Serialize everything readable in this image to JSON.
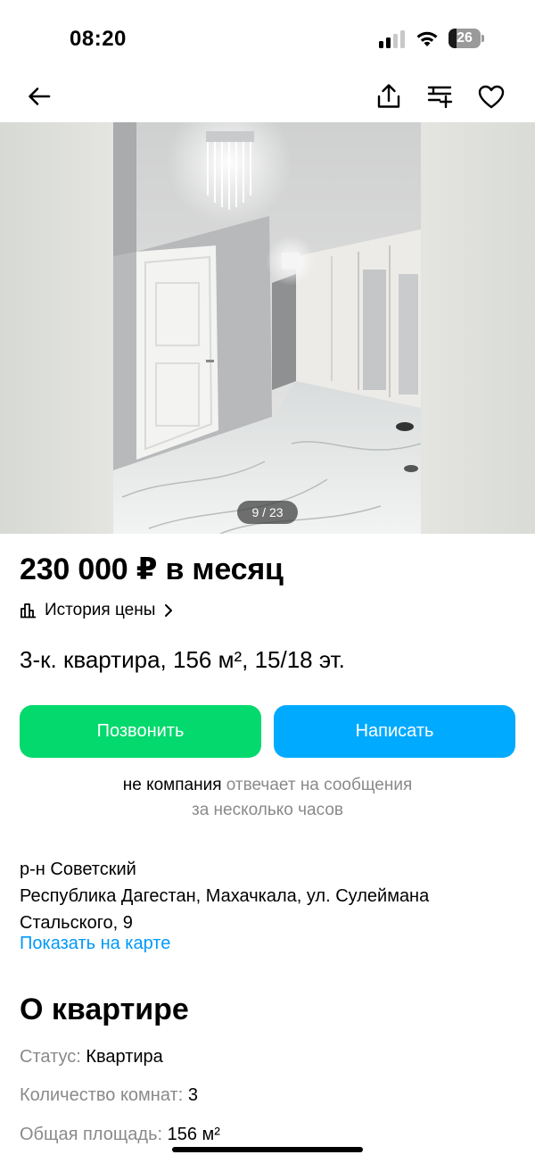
{
  "status_bar": {
    "time": "08:20",
    "battery_level": "26"
  },
  "nav": {
    "back_icon": "arrow-left-icon",
    "share_icon": "share-icon",
    "compare_icon": "list-add-icon",
    "favorite_icon": "heart-icon"
  },
  "gallery": {
    "counter": "9 / 23",
    "current": 9,
    "total": 23
  },
  "listing": {
    "price": "230 000 ₽ в месяц",
    "price_history_label": "История цены",
    "title": "3-к. квартира, 156 м², 15/18 эт."
  },
  "actions": {
    "call_label": "Позвонить",
    "write_label": "Написать"
  },
  "seller_note": {
    "who": "не компания",
    "reply_line1": " отвечает на сообщения",
    "reply_line2": "за несколько часов"
  },
  "location": {
    "district": "р-н Советский",
    "address_line1": "Республика Дагестан, Махачкала, ул. Сулеймана",
    "address_line2": "Стальского, 9",
    "map_link": "Показать на карте"
  },
  "about": {
    "title": "О квартире",
    "params": [
      {
        "key": "Статус:",
        "value": "Квартира"
      },
      {
        "key": "Количество комнат:",
        "value": "3"
      },
      {
        "key": "Общая площадь:",
        "value": "156 м²"
      }
    ]
  },
  "colors": {
    "call_button": "#03d96d",
    "write_button": "#00aaff",
    "link": "#0099f7",
    "secondary_text": "#8a8a8a"
  }
}
